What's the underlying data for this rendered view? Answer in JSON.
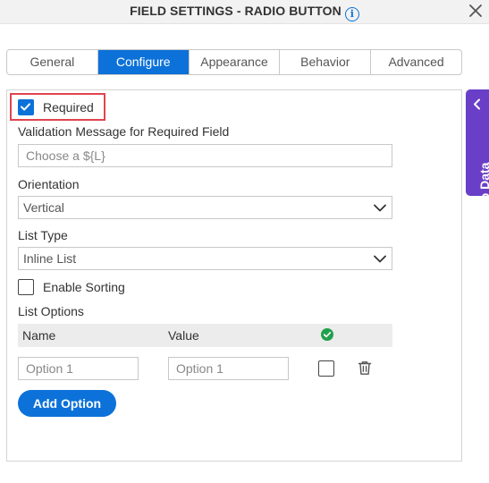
{
  "dialog": {
    "title": "FIELD SETTINGS - RADIO BUTTON",
    "info_icon": "info-icon",
    "info_glyph": "i",
    "close_icon": "close-icon"
  },
  "tabs": [
    {
      "label": "General",
      "active": false
    },
    {
      "label": "Configure",
      "active": true
    },
    {
      "label": "Appearance",
      "active": false
    },
    {
      "label": "Behavior",
      "active": false
    },
    {
      "label": "Advanced",
      "active": false
    }
  ],
  "configure": {
    "required": {
      "label": "Required",
      "checked": true
    },
    "validation_message": {
      "label": "Validation Message for Required Field",
      "placeholder": "Choose a ${L}",
      "value": ""
    },
    "orientation": {
      "label": "Orientation",
      "value": "Vertical"
    },
    "list_type": {
      "label": "List Type",
      "value": "Inline List"
    },
    "enable_sorting": {
      "label": "Enable Sorting",
      "checked": false
    },
    "list_options": {
      "label": "List Options",
      "columns": [
        "Name",
        "Value"
      ],
      "default_column_icon": "check-circle-icon",
      "rows": [
        {
          "name_placeholder": "Option 1",
          "value_placeholder": "Option 1",
          "default": false,
          "delete_icon": "trash-icon"
        }
      ],
      "add_button": "Add Option"
    }
  },
  "side_tab": {
    "label": "App Data",
    "icon": "chevron-left-icon"
  },
  "colors": {
    "accent": "#0c72d9",
    "side_tab": "#6a3fc7",
    "highlight_border": "#e0454f",
    "check_green": "#21a04b"
  }
}
